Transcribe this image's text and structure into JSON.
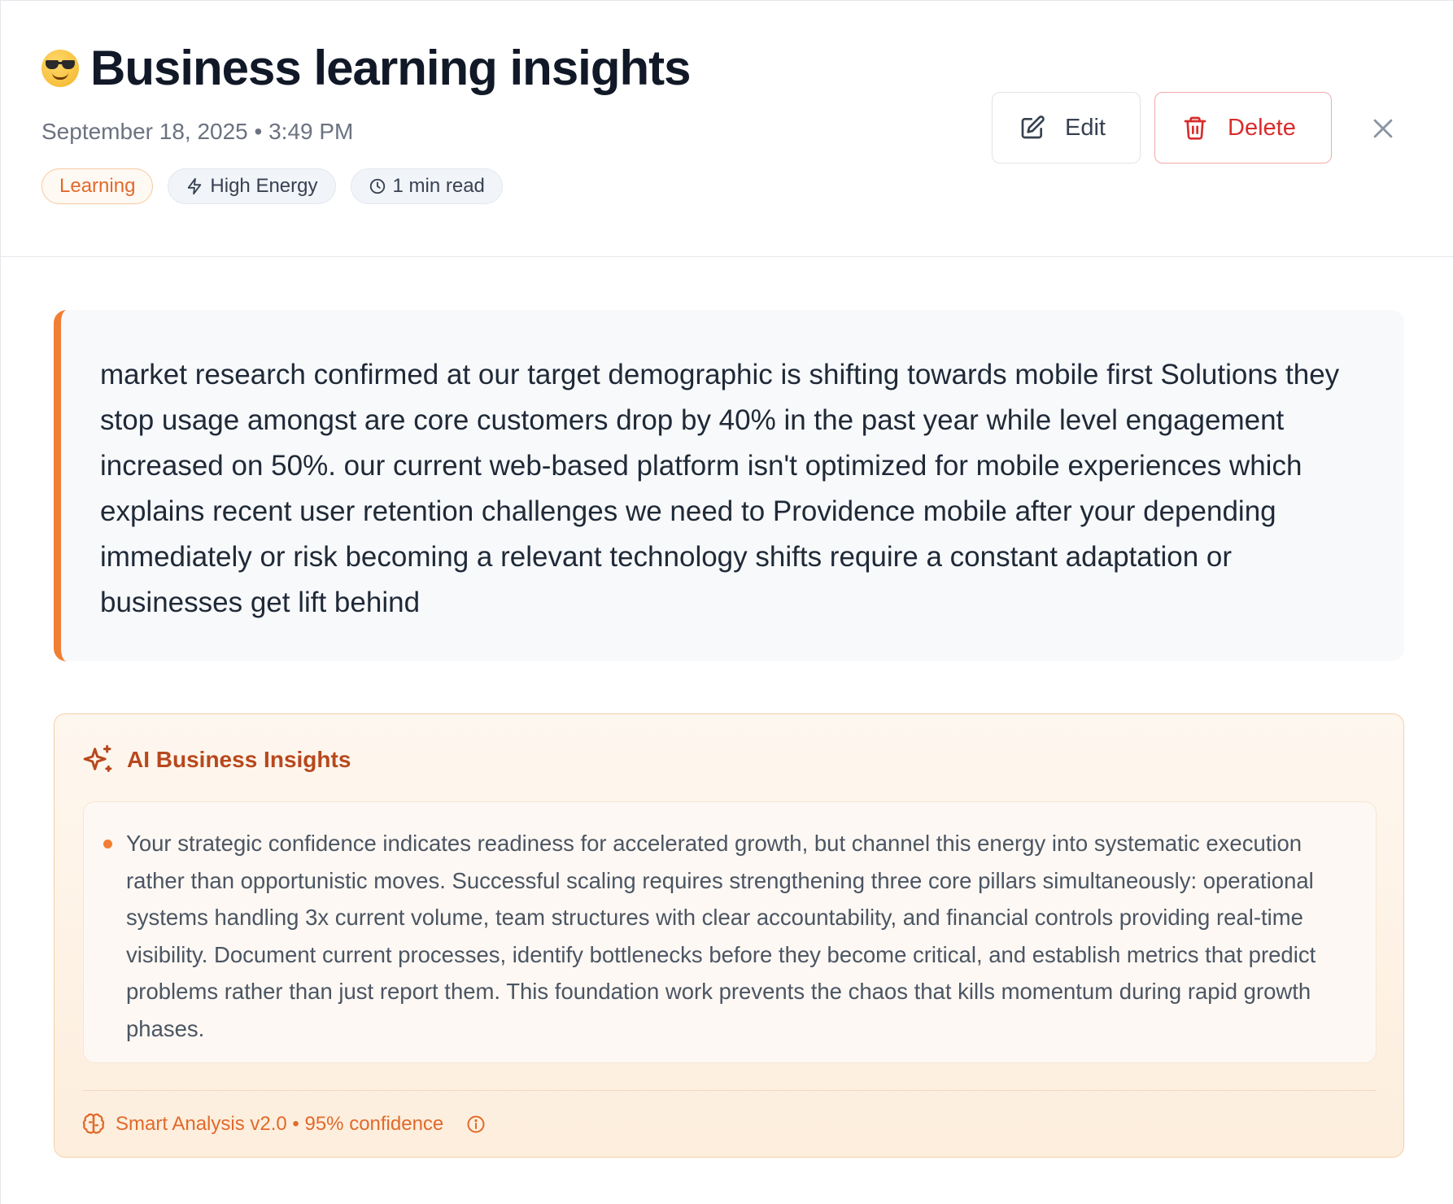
{
  "header": {
    "title": "Business learning insights",
    "mood_icon": "sunglasses-emoji",
    "date_time": "September 18, 2025 • 3:49 PM",
    "tags": {
      "category": "Learning",
      "energy": "High Energy",
      "read_time": "1 min read"
    },
    "buttons": {
      "edit": "Edit",
      "delete": "Delete"
    }
  },
  "note": {
    "text": "market research confirmed at our target demographic is shifting towards mobile first Solutions they stop usage amongst are core customers drop by 40% in the past year while level engagement increased on 50%. our current web-based platform isn't optimized for mobile experiences which explains recent user retention challenges we need to Providence mobile after your depending immediately or risk becoming a relevant technology shifts require a constant adaptation or businesses get lift behind"
  },
  "ai_insights": {
    "title": "AI Business Insights",
    "insight": "Your strategic confidence indicates readiness for accelerated growth, but channel this energy into systematic execution rather than opportunistic moves. Successful scaling requires strengthening three core pillars simultaneously: operational systems handling 3x current volume, team structures with clear accountability, and financial controls providing real-time visibility. Document current processes, identify bottlenecks before they become critical, and establish metrics that predict problems rather than just report them. This foundation work prevents the chaos that kills momentum during rapid growth phases.",
    "footer": "Smart Analysis v2.0 • 95% confidence"
  },
  "colors": {
    "accent_orange": "#f07f34",
    "delete_red": "#d92c2c",
    "title_dark": "#111827"
  }
}
